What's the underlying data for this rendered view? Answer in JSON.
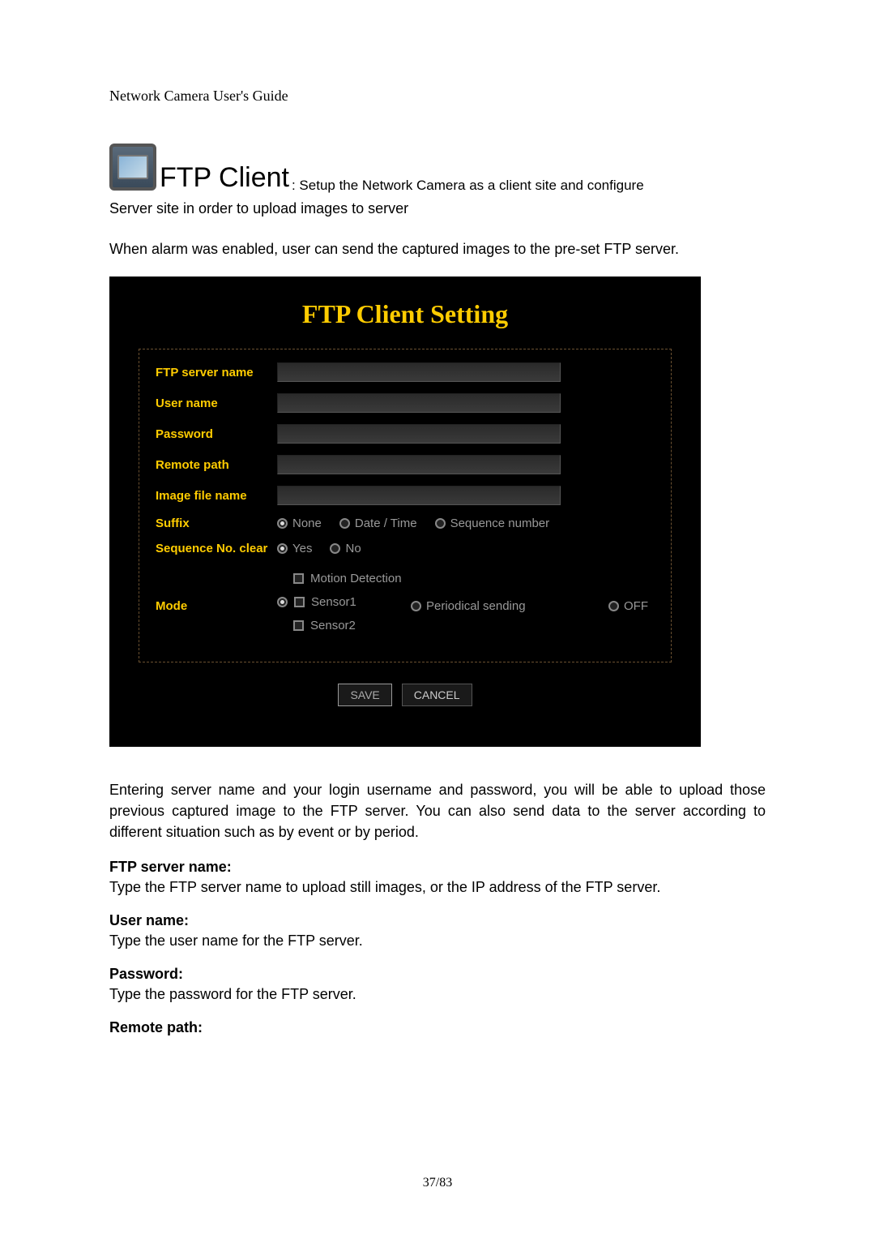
{
  "header": "Network Camera User's Guide",
  "section": {
    "title": "FTP Client",
    "subtitle": ": Setup the Network Camera as a client site and configure",
    "introLine": "Server site in order to upload images to server",
    "introParagraph": "When alarm was enabled, user can send the captured images to the pre-set FTP server."
  },
  "panel": {
    "title": "FTP Client Setting",
    "labels": {
      "ftpServerName": "FTP server name",
      "userName": "User name",
      "password": "Password",
      "remotePath": "Remote path",
      "imageFileName": "Image file name",
      "suffix": "Suffix",
      "sequenceNoClear": "Sequence No. clear",
      "mode": "Mode"
    },
    "suffixOptions": {
      "none": "None",
      "dateTime": "Date / Time",
      "sequenceNumber": "Sequence number"
    },
    "seqClearOptions": {
      "yes": "Yes",
      "no": "No"
    },
    "modeOptions": {
      "motionDetection": "Motion Detection",
      "sensor1": "Sensor1",
      "sensor2": "Sensor2",
      "periodicalSending": "Periodical sending",
      "off": "OFF"
    },
    "buttons": {
      "save": "SAVE",
      "cancel": "CANCEL"
    }
  },
  "description": {
    "mainPara": "Entering server name and your login username and password, you will be able to upload those previous captured image to the FTP server. You can also send data to the server according to different situation such as by event or by period.",
    "fields": [
      {
        "heading": "FTP server name:",
        "text": "Type the FTP server name to upload still images, or the IP address of the FTP server."
      },
      {
        "heading": "User name:",
        "text": "Type the user name for the FTP server."
      },
      {
        "heading": "Password:",
        "text": "Type the password for the FTP server."
      },
      {
        "heading": "Remote path:",
        "text": ""
      }
    ]
  },
  "pageNumber": "37/83"
}
